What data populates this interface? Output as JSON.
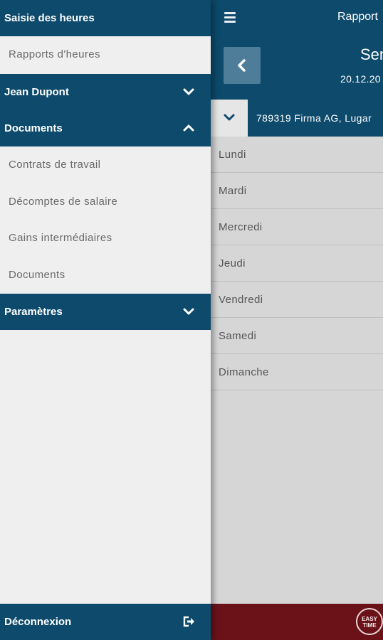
{
  "app": {
    "title": "Rapport",
    "week_label": "Sen",
    "week_date": "20.12.20",
    "company": "789319 Firma AG, Lugar",
    "days": [
      "Lundi",
      "Mardi",
      "Mercredi",
      "Jeudi",
      "Vendredi",
      "Samedi",
      "Dimanche"
    ],
    "logo_text_line1": "EASY",
    "logo_text_line2": "TIME"
  },
  "drawer": {
    "time_entry": "Saisie des heures",
    "time_reports": "Rapports d'heures",
    "user": "Jean Dupont",
    "documents": "Documents",
    "doc_items": [
      "Contrats de travail",
      "Décomptes de salaire",
      "Gains intermédiaires",
      "Documents"
    ],
    "settings": "Paramètres",
    "logout": "Déconnexion"
  },
  "colors": {
    "primary": "#0d4a6b",
    "accent_footer": "#6b1219",
    "drawer_bg": "#efefef"
  },
  "icons": [
    "menu-icon",
    "chevron-left-icon",
    "chevron-down-icon",
    "chevron-up-icon",
    "logout-icon"
  ]
}
